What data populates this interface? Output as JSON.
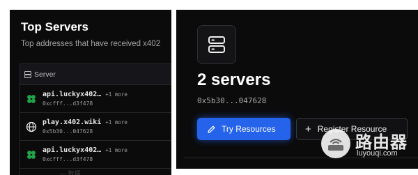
{
  "left_panel": {
    "title": "Top Servers",
    "subtitle": "Top addresses that have received x402",
    "table": {
      "header": "Server",
      "rows": [
        {
          "icon": "clover-icon",
          "host": "api.luckyx402…",
          "more": "+1 more",
          "address": "0xcfff...d3f478"
        },
        {
          "icon": "globe-icon",
          "host": "play.x402.wiki",
          "more": "+1 more",
          "address": "0x5b30...047628"
        },
        {
          "icon": "clover-icon",
          "host": "api.luckyx402…",
          "more": "+1 more",
          "address": "0xcfff...d3f478"
        }
      ]
    }
  },
  "right_panel": {
    "count_title": "2 servers",
    "address": "0x5b30...047628",
    "try_button": "Try Resources",
    "register_button": "Register Resource"
  },
  "watermark": {
    "name": "路由器",
    "domain": "luyouqi.com"
  },
  "bottom_fragment": "— 数据",
  "colors": {
    "background": "#0b0b0c",
    "accent_blue": "#2563eb",
    "clover_green": "#22a34a"
  }
}
